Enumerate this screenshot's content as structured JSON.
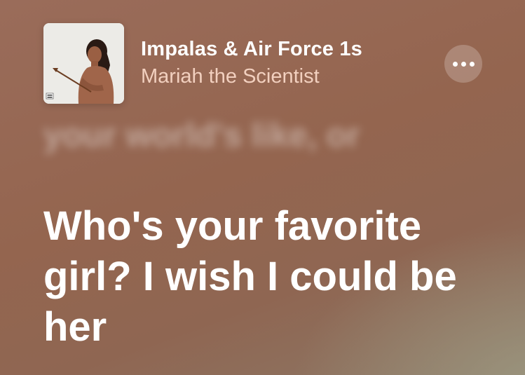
{
  "now_playing": {
    "album_art": "album-cover-image",
    "title": "Impalas & Air Force 1s",
    "artist": "Mariah the Scientist",
    "more_icon": "more-options-icon"
  },
  "lyrics": {
    "previous_line": "your world's like, or",
    "current_line": "Who's your favorite girl? I wish I could be her"
  },
  "colors": {
    "background": "#94654f",
    "title": "#ffffff",
    "artist": "#f2d0bf"
  }
}
